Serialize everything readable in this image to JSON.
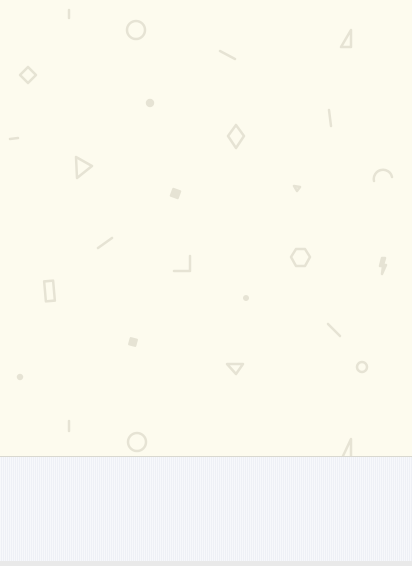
{
  "colors": {
    "pattern_background": "#fdfbee",
    "shape_stroke": "#e6e3d4",
    "divider": "#d9d8d0",
    "bottom_panel": "#f7f8fb",
    "bottom_strip": "#e9e9e9"
  },
  "decorations": {
    "style": "scattered faint geometric doodle shapes",
    "shape_kinds": [
      "line",
      "circle",
      "diamond",
      "triangle",
      "square",
      "hexagon",
      "rectangle",
      "arc",
      "corner",
      "dot"
    ]
  }
}
